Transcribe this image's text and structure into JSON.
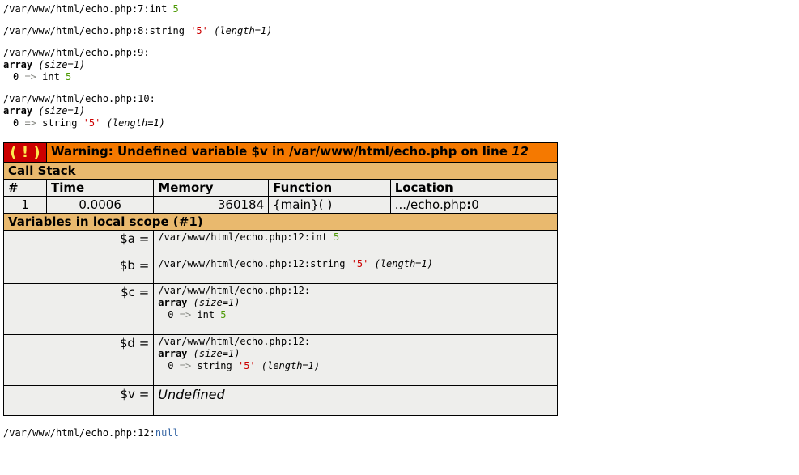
{
  "dumps": {
    "d1": {
      "path": "/var/www/html/echo.php:7:",
      "type": "int ",
      "val": "5"
    },
    "d2": {
      "path": "/var/www/html/echo.php:8:",
      "type": "string ",
      "val": "'5'",
      "len": " (length=1)"
    },
    "d3": {
      "path": "/var/www/html/echo.php:9:",
      "arr": "array",
      "size": " (size=1)",
      "key": "0 ",
      "arrow": "=>",
      "itype": " int ",
      "ival": "5"
    },
    "d4": {
      "path": "/var/www/html/echo.php:10:",
      "arr": "array",
      "size": " (size=1)",
      "key": "0 ",
      "arrow": "=>",
      "itype": " string ",
      "ival": "'5'",
      "ilen": " (length=1)"
    }
  },
  "error": {
    "bang": "( ! )",
    "msg_prefix": "Warning: Undefined variable $v in /var/www/html/echo.php on line ",
    "line": "12",
    "callstack_label": "Call Stack",
    "cols": {
      "num": "#",
      "time": "Time",
      "mem": "Memory",
      "func": "Function",
      "loc": "Location"
    },
    "row": {
      "num": "1",
      "time": "0.0006",
      "mem": "360184",
      "func": "{main}( )",
      "loc_pre": ".../echo.php",
      "loc_colon": ":",
      "loc_line": "0"
    },
    "scope_label": "Variables in local scope (#1)"
  },
  "vars": {
    "a": {
      "name": "$a =",
      "path": "/var/www/html/echo.php:12:",
      "type": "int ",
      "val": "5"
    },
    "b": {
      "name": "$b =",
      "path": "/var/www/html/echo.php:12:",
      "type": "string ",
      "val": "'5'",
      "len": " (length=1)"
    },
    "c": {
      "name": "$c =",
      "path": "/var/www/html/echo.php:12:",
      "arr": "array",
      "size": " (size=1)",
      "key": "0 ",
      "arrow": "=>",
      "itype": " int ",
      "ival": "5"
    },
    "d": {
      "name": "$d =",
      "path": "/var/www/html/echo.php:12:",
      "arr": "array",
      "size": " (size=1)",
      "key": "0 ",
      "arrow": "=>",
      "itype": " string ",
      "ival": "'5'",
      "ilen": " (length=1)"
    },
    "v": {
      "name": "$v =",
      "val": "Undefined"
    }
  },
  "final": {
    "path": "/var/www/html/echo.php:12:",
    "val": "null"
  }
}
